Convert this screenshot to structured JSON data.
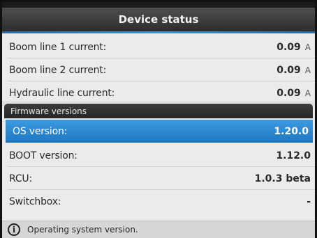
{
  "title": "Device status",
  "currents": [
    {
      "label": "Boom line 1 current:",
      "value": "0.09",
      "unit": "A"
    },
    {
      "label": "Boom line 2 current:",
      "value": "0.09",
      "unit": "A"
    },
    {
      "label": "Hydraulic line current:",
      "value": "0.09",
      "unit": "A"
    }
  ],
  "firmware": {
    "header": "Firmware versions",
    "items": [
      {
        "label": "OS version:",
        "value": "1.20.0",
        "selected": true
      },
      {
        "label": "BOOT version:",
        "value": "1.12.0"
      },
      {
        "label": "RCU:",
        "value": "1.0.3 beta"
      },
      {
        "label": "Switchbox:",
        "value": "-"
      }
    ]
  },
  "status": {
    "icon": "info-icon",
    "text": "Operating system version."
  },
  "colors": {
    "accent": "#2a88d0",
    "title_bg": "#3a3a3a",
    "background": "#ebebeb"
  }
}
